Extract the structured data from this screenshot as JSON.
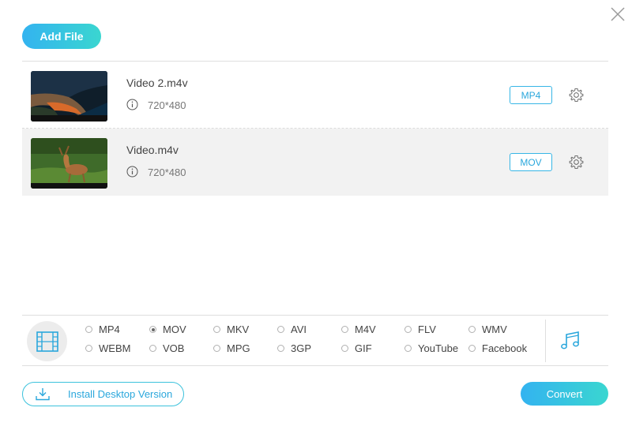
{
  "header": {
    "add_file_label": "Add File",
    "close_icon": "close-icon"
  },
  "files": [
    {
      "name": "Video 2.m4v",
      "resolution": "720*480",
      "format": "MP4",
      "thumbnail": "coastline-aerial-thumbnail"
    },
    {
      "name": "Video.m4v",
      "resolution": "720*480",
      "format": "MOV",
      "thumbnail": "deer-in-grass-thumbnail"
    }
  ],
  "formats": {
    "video_icon": "film-strip-icon",
    "audio_icon": "music-note-icon",
    "selected": "MOV",
    "row1": [
      "MP4",
      "MOV",
      "MKV",
      "AVI",
      "M4V",
      "FLV",
      "WMV"
    ],
    "row2": [
      "WEBM",
      "VOB",
      "MPG",
      "3GP",
      "GIF",
      "YouTube",
      "Facebook"
    ]
  },
  "footer": {
    "install_label": "Install Desktop Version",
    "convert_label": "Convert"
  },
  "colors": {
    "accent": "#2aa7dc",
    "gradient_start": "#33b3f0",
    "gradient_end": "#3ad6d0"
  }
}
